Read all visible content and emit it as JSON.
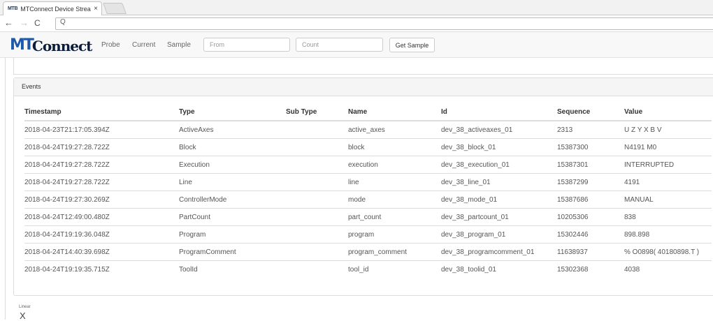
{
  "browser": {
    "tab_title": "MTConnect Device Strea",
    "favicon": "MTB",
    "close_glyph": "×",
    "back": "←",
    "forward": "→",
    "reload": "C",
    "search_glyph": "Q"
  },
  "header": {
    "logo_mt": "MT",
    "logo_connect": "Connect",
    "nav": [
      "Probe",
      "Current",
      "Sample"
    ],
    "from_placeholder": "From",
    "count_placeholder": "Count",
    "button_label": "Get Sample",
    "brand_color": "#1e5aa8"
  },
  "events": {
    "heading": "Events",
    "columns": [
      "Timestamp",
      "Type",
      "Sub Type",
      "Name",
      "Id",
      "Sequence",
      "Value"
    ],
    "rows": [
      [
        "2018-04-23T21:17:05.394Z",
        "ActiveAxes",
        "",
        "active_axes",
        "dev_38_activeaxes_01",
        "2313",
        "U Z Y X B V"
      ],
      [
        "2018-04-24T19:27:28.722Z",
        "Block",
        "",
        "block",
        "dev_38_block_01",
        "15387300",
        "N4191 M0"
      ],
      [
        "2018-04-24T19:27:28.722Z",
        "Execution",
        "",
        "execution",
        "dev_38_execution_01",
        "15387301",
        "INTERRUPTED"
      ],
      [
        "2018-04-24T19:27:28.722Z",
        "Line",
        "",
        "line",
        "dev_38_line_01",
        "15387299",
        "4191"
      ],
      [
        "2018-04-24T19:27:30.269Z",
        "ControllerMode",
        "",
        "mode",
        "dev_38_mode_01",
        "15387686",
        "MANUAL"
      ],
      [
        "2018-04-24T12:49:00.480Z",
        "PartCount",
        "",
        "part_count",
        "dev_38_partcount_01",
        "10205306",
        "838"
      ],
      [
        "2018-04-24T19:19:36.048Z",
        "Program",
        "",
        "program",
        "dev_38_program_01",
        "15302446",
        "898.898"
      ],
      [
        "2018-04-24T14:40:39.698Z",
        "ProgramComment",
        "",
        "program_comment",
        "dev_38_programcomment_01",
        "11638937",
        "% O0898( 40180898.T )"
      ],
      [
        "2018-04-24T19:19:35.715Z",
        "ToolId",
        "",
        "tool_id",
        "dev_38_toolid_01",
        "15302368",
        "4038"
      ]
    ]
  },
  "linear": {
    "label": "Linear",
    "axis": "X"
  }
}
